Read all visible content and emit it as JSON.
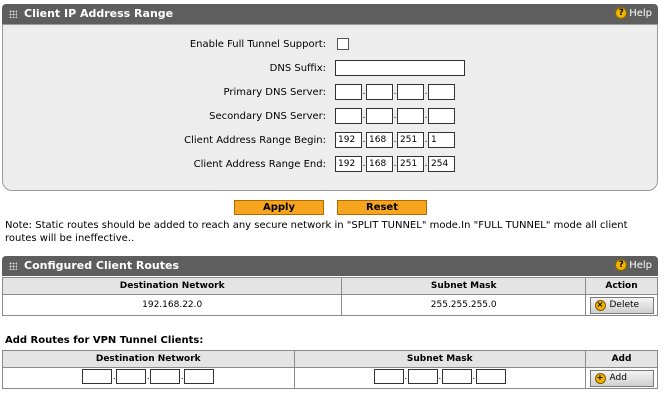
{
  "client_range": {
    "title": "Client IP Address Range",
    "help_label": "Help",
    "fields": {
      "full_tunnel_label": "Enable Full Tunnel Support:",
      "dns_suffix_label": "DNS Suffix:",
      "primary_dns_label": "Primary DNS Server:",
      "secondary_dns_label": "Secondary DNS Server:",
      "range_begin_label": "Client Address Range Begin:",
      "range_end_label": "Client Address Range End:",
      "range_begin": [
        "192",
        "168",
        "251",
        "1"
      ],
      "range_end": [
        "192",
        "168",
        "251",
        "254"
      ]
    }
  },
  "buttons": {
    "apply": "Apply",
    "reset": "Reset"
  },
  "note": "Note: Static routes should be added to reach any secure network in \"SPLIT TUNNEL\" mode.In \"FULL TUNNEL\" mode all client routes will be ineffective..",
  "configured_routes": {
    "title": "Configured Client Routes",
    "help_label": "Help",
    "columns": [
      "Destination Network",
      "Subnet Mask",
      "Action"
    ],
    "rows": [
      {
        "destination": "192.168.22.0",
        "mask": "255.255.255.0",
        "action": "Delete"
      }
    ]
  },
  "add_routes": {
    "title": "Add Routes for VPN Tunnel Clients:",
    "columns": [
      "Destination Network",
      "Subnet Mask",
      "Add"
    ],
    "add_label": "Add"
  },
  "icons": {
    "help": "help-icon",
    "delete": "delete-icon",
    "add": "add-icon"
  },
  "colors": {
    "header": "#5e5e5e",
    "button": "#f7a51f",
    "help": "#f0b400"
  }
}
